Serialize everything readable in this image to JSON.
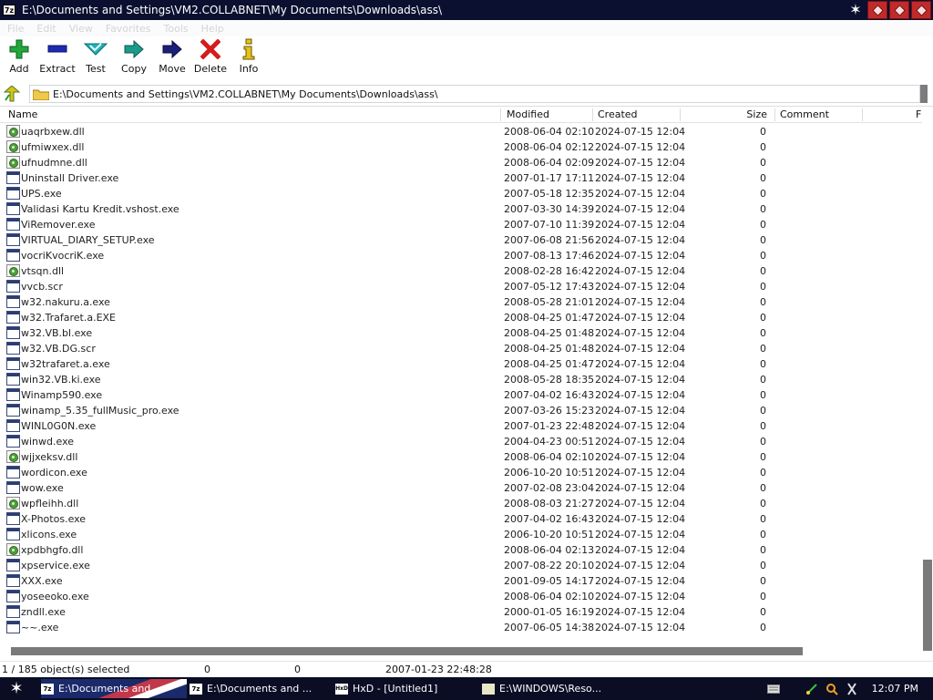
{
  "window": {
    "app_icon": "7z",
    "title": "E:\\Documents and Settings\\VM2.COLLABNET\\My Documents\\Downloads\\ass\\"
  },
  "menu": [
    "File",
    "Edit",
    "View",
    "Favorites",
    "Tools",
    "Help"
  ],
  "toolbar": [
    {
      "label": "Add",
      "icon": "plus-icon",
      "color": "#21a83a"
    },
    {
      "label": "Extract",
      "icon": "minus-icon",
      "color": "#1c2bb0"
    },
    {
      "label": "Test",
      "icon": "check-icon",
      "color": "#1fb2b8"
    },
    {
      "label": "Copy",
      "icon": "arrow-right-icon",
      "color": "#1a9a8a"
    },
    {
      "label": "Move",
      "icon": "arrow-right-icon",
      "color": "#1a1f7a"
    },
    {
      "label": "Delete",
      "icon": "x-icon",
      "color": "#d41c1c"
    },
    {
      "label": "Info",
      "icon": "info-icon",
      "color": "#e6c21a"
    }
  ],
  "address": {
    "path": "E:\\Documents and Settings\\VM2.COLLABNET\\My Documents\\Downloads\\ass\\"
  },
  "columns": {
    "name": "Name",
    "modified": "Modified",
    "created": "Created",
    "size": "Size",
    "comment": "Comment",
    "f": "F"
  },
  "files": [
    {
      "name": "uaqrbxew.dll",
      "type": "dll",
      "modified": "2008-06-04 02:10",
      "created": "2024-07-15 12:04",
      "size": "0"
    },
    {
      "name": "ufmiwxex.dll",
      "type": "dll",
      "modified": "2008-06-04 02:12",
      "created": "2024-07-15 12:04",
      "size": "0"
    },
    {
      "name": "ufnudmne.dll",
      "type": "dll",
      "modified": "2008-06-04 02:09",
      "created": "2024-07-15 12:04",
      "size": "0"
    },
    {
      "name": "Uninstall Driver.exe",
      "type": "exe",
      "modified": "2007-01-17 17:11",
      "created": "2024-07-15 12:04",
      "size": "0"
    },
    {
      "name": "UPS.exe",
      "type": "exe",
      "modified": "2007-05-18 12:35",
      "created": "2024-07-15 12:04",
      "size": "0"
    },
    {
      "name": "Validasi Kartu Kredit.vshost.exe",
      "type": "exe",
      "modified": "2007-03-30 14:39",
      "created": "2024-07-15 12:04",
      "size": "0"
    },
    {
      "name": "ViRemover.exe",
      "type": "exe",
      "modified": "2007-07-10 11:39",
      "created": "2024-07-15 12:04",
      "size": "0"
    },
    {
      "name": "VIRTUAL_DIARY_SETUP.exe",
      "type": "exe",
      "modified": "2007-06-08 21:56",
      "created": "2024-07-15 12:04",
      "size": "0"
    },
    {
      "name": "vocriKvocriK.exe",
      "type": "exe",
      "modified": "2007-08-13 17:46",
      "created": "2024-07-15 12:04",
      "size": "0"
    },
    {
      "name": "vtsqn.dll",
      "type": "dll",
      "modified": "2008-02-28 16:42",
      "created": "2024-07-15 12:04",
      "size": "0"
    },
    {
      "name": "vvcb.scr",
      "type": "exe",
      "modified": "2007-05-12 17:43",
      "created": "2024-07-15 12:04",
      "size": "0"
    },
    {
      "name": "w32.nakuru.a.exe",
      "type": "exe",
      "modified": "2008-05-28 21:01",
      "created": "2024-07-15 12:04",
      "size": "0"
    },
    {
      "name": "w32.Trafaret.a.EXE",
      "type": "exe",
      "modified": "2008-04-25 01:47",
      "created": "2024-07-15 12:04",
      "size": "0"
    },
    {
      "name": "w32.VB.bl.exe",
      "type": "exe",
      "modified": "2008-04-25 01:48",
      "created": "2024-07-15 12:04",
      "size": "0"
    },
    {
      "name": "w32.VB.DG.scr",
      "type": "exe",
      "modified": "2008-04-25 01:48",
      "created": "2024-07-15 12:04",
      "size": "0"
    },
    {
      "name": "w32trafaret.a.exe",
      "type": "exe",
      "modified": "2008-04-25 01:47",
      "created": "2024-07-15 12:04",
      "size": "0"
    },
    {
      "name": "win32.VB.ki.exe",
      "type": "exe",
      "modified": "2008-05-28 18:35",
      "created": "2024-07-15 12:04",
      "size": "0"
    },
    {
      "name": "Winamp590.exe",
      "type": "exe",
      "modified": "2007-04-02 16:43",
      "created": "2024-07-15 12:04",
      "size": "0"
    },
    {
      "name": "winamp_5.35_fullMusic_pro.exe",
      "type": "exe",
      "modified": "2007-03-26 15:23",
      "created": "2024-07-15 12:04",
      "size": "0"
    },
    {
      "name": "WINL0G0N.exe",
      "type": "exe",
      "modified": "2007-01-23 22:48",
      "created": "2024-07-15 12:04",
      "size": "0"
    },
    {
      "name": "winwd.exe",
      "type": "exe",
      "modified": "2004-04-23 00:51",
      "created": "2024-07-15 12:04",
      "size": "0"
    },
    {
      "name": "wjjxeksv.dll",
      "type": "dll",
      "modified": "2008-06-04 02:10",
      "created": "2024-07-15 12:04",
      "size": "0"
    },
    {
      "name": "wordicon.exe",
      "type": "exe",
      "modified": "2006-10-20 10:51",
      "created": "2024-07-15 12:04",
      "size": "0"
    },
    {
      "name": "wow.exe",
      "type": "exe",
      "modified": "2007-02-08 23:04",
      "created": "2024-07-15 12:04",
      "size": "0"
    },
    {
      "name": "wpfleihh.dll",
      "type": "dll",
      "modified": "2008-08-03 21:27",
      "created": "2024-07-15 12:04",
      "size": "0"
    },
    {
      "name": "X-Photos.exe",
      "type": "exe",
      "modified": "2007-04-02 16:43",
      "created": "2024-07-15 12:04",
      "size": "0"
    },
    {
      "name": "xlicons.exe",
      "type": "exe",
      "modified": "2006-10-20 10:51",
      "created": "2024-07-15 12:04",
      "size": "0"
    },
    {
      "name": "xpdbhgfo.dll",
      "type": "dll",
      "modified": "2008-06-04 02:13",
      "created": "2024-07-15 12:04",
      "size": "0"
    },
    {
      "name": "xpservice.exe",
      "type": "exe",
      "modified": "2007-08-22 20:10",
      "created": "2024-07-15 12:04",
      "size": "0"
    },
    {
      "name": "XXX.exe",
      "type": "exe",
      "modified": "2001-09-05 14:17",
      "created": "2024-07-15 12:04",
      "size": "0"
    },
    {
      "name": "yoseeoko.exe",
      "type": "exe",
      "modified": "2008-06-04 02:10",
      "created": "2024-07-15 12:04",
      "size": "0"
    },
    {
      "name": "zndll.exe",
      "type": "exe",
      "modified": "2000-01-05 16:19",
      "created": "2024-07-15 12:04",
      "size": "0"
    },
    {
      "name": "~~.exe",
      "type": "exe",
      "modified": "2007-06-05 14:38",
      "created": "2024-07-15 12:04",
      "size": "0"
    }
  ],
  "status": {
    "selection": "1 / 185 object(s) selected",
    "size": "0",
    "packed": "0",
    "date": "2007-01-23 22:48:28"
  },
  "taskbar": {
    "tasks": [
      {
        "label": "E:\\Documents and ...",
        "icon": "7z",
        "active": true
      },
      {
        "label": "E:\\Documents and ...",
        "icon": "7z",
        "active": false
      },
      {
        "label": "HxD - [Untitled1]",
        "icon": "HxD",
        "active": false
      },
      {
        "label": "E:\\WINDOWS\\Reso...",
        "icon": "notepad",
        "active": false
      }
    ],
    "clock": "12:07 PM"
  }
}
